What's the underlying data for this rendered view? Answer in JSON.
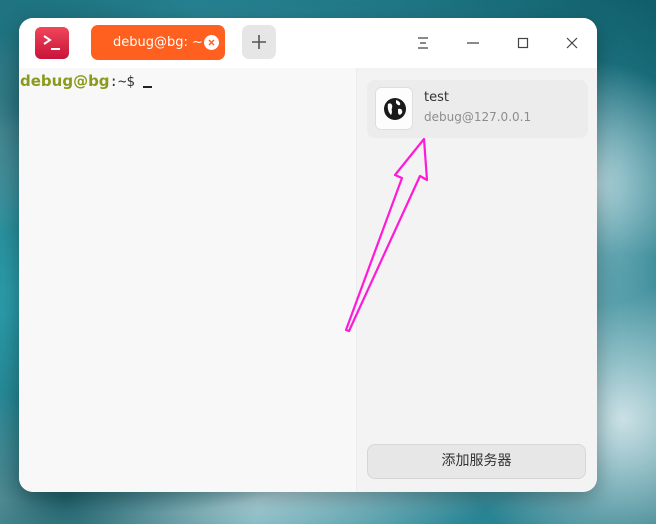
{
  "tab": {
    "label": "debug@bg: ~"
  },
  "prompt": {
    "user_host": "debug@bg",
    "separator": ":",
    "path": "~$"
  },
  "servers": [
    {
      "name": "test",
      "address": "debug@127.0.0.1"
    }
  ],
  "panel": {
    "add_server_label": "添加服务器"
  },
  "colors": {
    "tab_active": "#ff5f1f",
    "prompt_user": "#8a9a1a",
    "annotation_arrow": "#ff1ad9"
  },
  "icons": [
    "terminal-app-icon",
    "close-icon",
    "plus-icon",
    "menu-icon",
    "minimize-icon",
    "maximize-icon",
    "window-close-icon",
    "globe-icon"
  ]
}
